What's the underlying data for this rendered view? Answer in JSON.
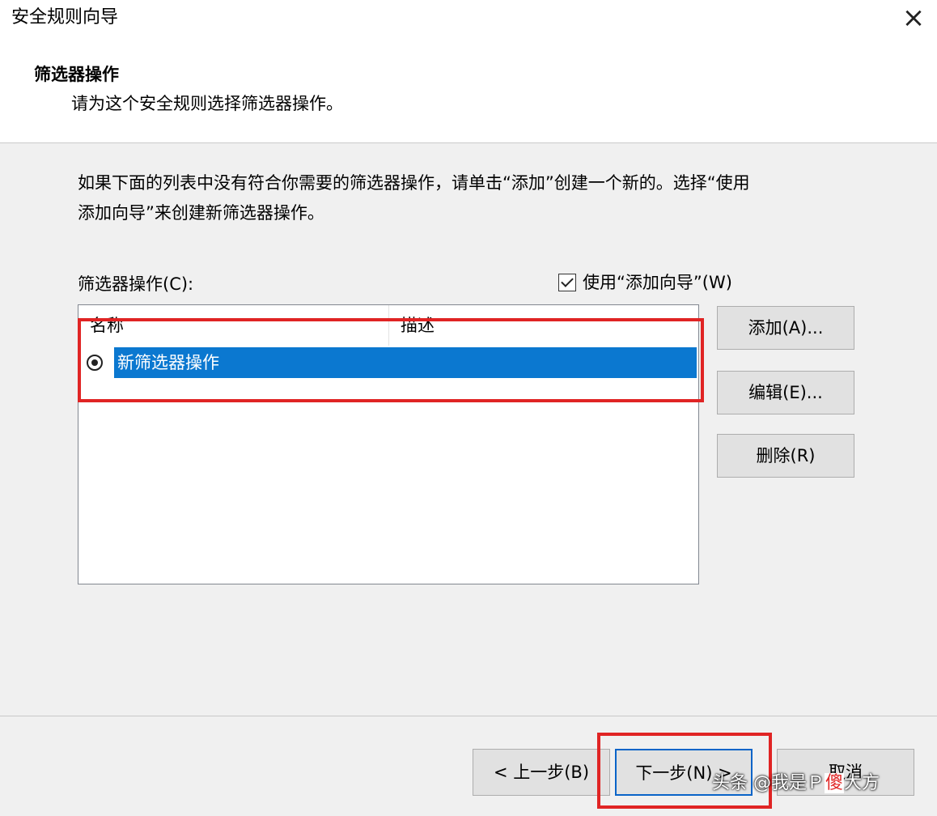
{
  "window": {
    "title": "安全规则向导"
  },
  "header": {
    "title": "筛选器操作",
    "subtitle": "请为这个安全规则选择筛选器操作。"
  },
  "main": {
    "description": "如果下面的列表中没有符合你需要的筛选器操作，请单击“添加”创建一个新的。选择“使用\n添加向导”来创建新筛选器操作。",
    "list_label": "筛选器操作(C):",
    "wizard_checkbox": {
      "label": "使用“添加向导”(W)",
      "checked": true
    },
    "list": {
      "columns": [
        "名称",
        "描述"
      ],
      "rows": [
        {
          "name": "新筛选器操作",
          "description": "",
          "selected": true
        }
      ]
    },
    "side_buttons": {
      "add": "添加(A)...",
      "edit": "编辑(E)...",
      "delete": "删除(R)"
    }
  },
  "footer": {
    "back": "< 上一步(B)",
    "next": "下一步(N) >",
    "cancel": "取消"
  },
  "watermark": {
    "prefix": "头条 @我是Ｐ",
    "accent": "傻",
    "suffix": "大方"
  },
  "colors": {
    "selection": "#0b78d0",
    "highlight_box": "#e02424",
    "background": "#f0f0f0"
  }
}
